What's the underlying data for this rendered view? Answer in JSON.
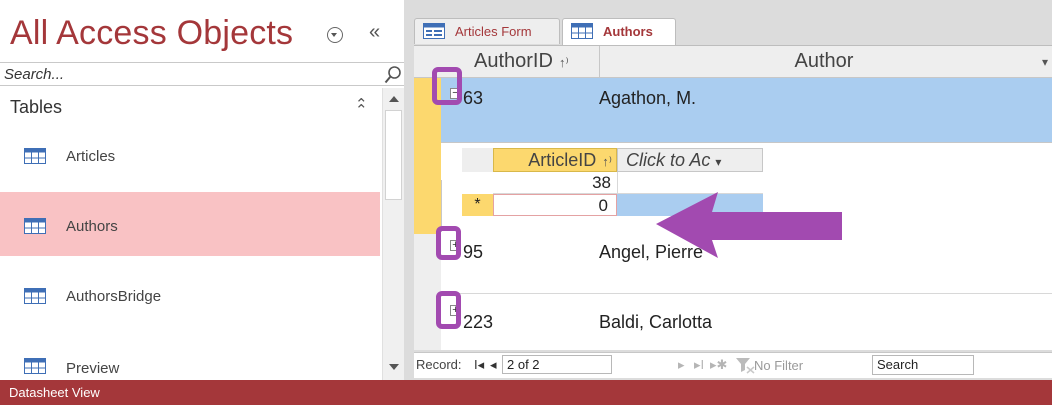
{
  "nav": {
    "title": "All Access Objects",
    "search_placeholder": "Search...",
    "group_label": "Tables",
    "items": [
      {
        "label": "Articles",
        "selected": false
      },
      {
        "label": "Authors",
        "selected": true
      },
      {
        "label": "AuthorsBridge",
        "selected": false
      },
      {
        "label": "Preview",
        "selected": false
      }
    ]
  },
  "tabs": [
    {
      "label": "Articles Form",
      "icon": "form-icon",
      "active": false
    },
    {
      "label": "Authors",
      "icon": "table-icon",
      "active": true
    }
  ],
  "grid": {
    "columns": [
      "AuthorID",
      "Author"
    ],
    "rows": [
      {
        "id": "63",
        "author": "Agathon, M.",
        "expanded": true
      },
      {
        "id": "95",
        "author": "Angel, Pierre",
        "expanded": false
      },
      {
        "id": "223",
        "author": "Baldi, Carlotta",
        "expanded": false
      }
    ],
    "subdatasheet": {
      "columns": [
        "ArticleID",
        "Click to Ac"
      ],
      "rows": [
        {
          "id": "38"
        }
      ],
      "new_row": {
        "marker": "*",
        "id": "0"
      }
    }
  },
  "navbar": {
    "label": "Record:",
    "current": "2 of 2",
    "filter_label": "No Filter",
    "search_label": "Search"
  },
  "status": {
    "text": "Datasheet View"
  },
  "colors": {
    "accent": "#a4373a",
    "selection_pink": "#f9c2c4",
    "row_selected": "#aacdf0",
    "record_selector": "#fcd86e",
    "annotation_purple": "#a24ab0"
  }
}
